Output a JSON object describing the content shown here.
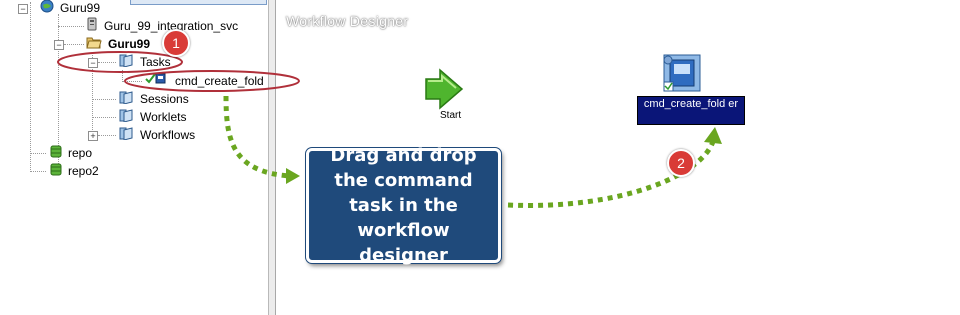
{
  "navigator": {
    "repository_root": "Guru99",
    "items": [
      {
        "label": "Guru_99_integration_svc",
        "icon": "integration-service-icon"
      },
      {
        "label": "Guru99",
        "icon": "open-folder-icon"
      },
      {
        "label": "Tasks",
        "icon": "folder-icon"
      },
      {
        "label": "cmd_create_fold",
        "icon": "command-task-icon"
      },
      {
        "label": "Sessions",
        "icon": "folder-icon"
      },
      {
        "label": "Worklets",
        "icon": "folder-icon"
      },
      {
        "label": "Workflows",
        "icon": "folder-icon"
      },
      {
        "label": "repo",
        "icon": "database-icon"
      },
      {
        "label": "repo2",
        "icon": "database-icon"
      }
    ]
  },
  "designer": {
    "title": "Workflow Designer",
    "start_label": "Start",
    "task_label": "cmd_create_fold er"
  },
  "annotations": {
    "callout_text": "Drag and drop the command task in the workflow designer",
    "step1": "1",
    "step2": "2",
    "accent_green": "#6aa620",
    "callout_bg": "#1f4a7b",
    "highlight_red": "#b0303a",
    "badge_red": "#d93b37"
  }
}
